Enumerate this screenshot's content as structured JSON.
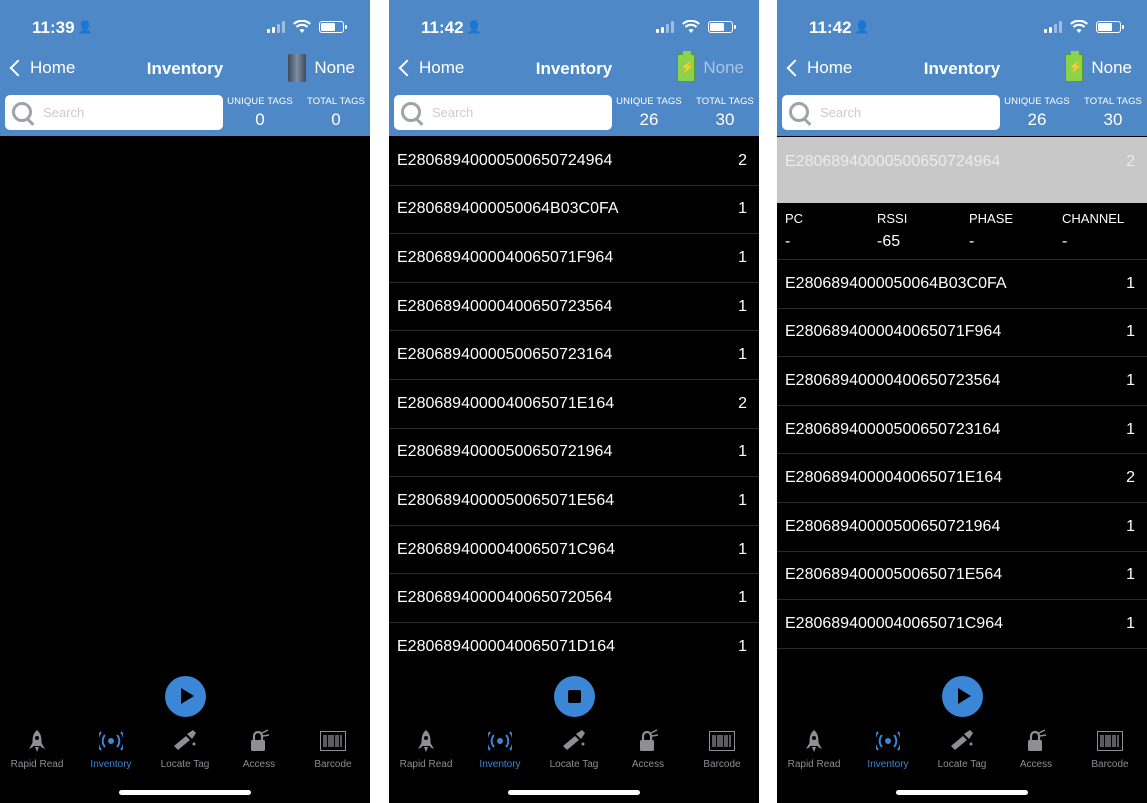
{
  "screens": [
    {
      "time": "11:39",
      "nav": {
        "back": "Home",
        "title": "Inventory",
        "reader": "None"
      },
      "search_placeholder": "Search",
      "counts": {
        "unique_label": "UNIQUE TAGS",
        "unique": "0",
        "total_label": "TOTAL TAGS",
        "total": "0"
      },
      "tags": [],
      "control": "play"
    },
    {
      "time": "11:42",
      "nav": {
        "back": "Home",
        "title": "Inventory",
        "reader": "None"
      },
      "search_placeholder": "Search",
      "counts": {
        "unique_label": "UNIQUE TAGS",
        "unique": "26",
        "total_label": "TOTAL TAGS",
        "total": "30"
      },
      "tags": [
        {
          "epc": "E2806894000050065072496​4",
          "count": "2"
        },
        {
          "epc": "E2806894000050064B03C0FA",
          "count": "1"
        },
        {
          "epc": "E2806894000040065071F964",
          "count": "1"
        },
        {
          "epc": "E28068940000400650723564",
          "count": "1"
        },
        {
          "epc": "E28068940000500650723164",
          "count": "1"
        },
        {
          "epc": "E2806894000040065071E164",
          "count": "2"
        },
        {
          "epc": "E28068940000500650721964",
          "count": "1"
        },
        {
          "epc": "E2806894000050065071E564",
          "count": "1"
        },
        {
          "epc": "E2806894000040065071C964",
          "count": "1"
        },
        {
          "epc": "E28068940000400650720564",
          "count": "1"
        },
        {
          "epc": "E2806894000040065071D164",
          "count": "1"
        }
      ],
      "control": "stop"
    },
    {
      "time": "11:42",
      "nav": {
        "back": "Home",
        "title": "Inventory",
        "reader": "None"
      },
      "search_placeholder": "Search",
      "counts": {
        "unique_label": "UNIQUE TAGS",
        "unique": "26",
        "total_label": "TOTAL TAGS",
        "total": "30"
      },
      "selected": {
        "epc": "E28068940000500650724964",
        "count": "2"
      },
      "details": [
        {
          "label": "PC",
          "value": "-"
        },
        {
          "label": "RSSI",
          "value": "-65"
        },
        {
          "label": "PHASE",
          "value": "-"
        },
        {
          "label": "CHANNEL",
          "value": "-"
        }
      ],
      "tags": [
        {
          "epc": "E2806894000050064B03C0FA",
          "count": "1"
        },
        {
          "epc": "E2806894000040065071F964",
          "count": "1"
        },
        {
          "epc": "E28068940000400650723564",
          "count": "1"
        },
        {
          "epc": "E28068940000500650723164",
          "count": "1"
        },
        {
          "epc": "E2806894000040065071E164",
          "count": "2"
        },
        {
          "epc": "E28068940000500650721964",
          "count": "1"
        },
        {
          "epc": "E2806894000050065071E564",
          "count": "1"
        },
        {
          "epc": "E2806894000040065071C964",
          "count": "1"
        }
      ],
      "control": "play"
    }
  ],
  "tabs": [
    {
      "label": "Rapid Read",
      "icon": "rapid-read-icon"
    },
    {
      "label": "Inventory",
      "icon": "inventory-icon",
      "active": true
    },
    {
      "label": "Locate Tag",
      "icon": "locate-tag-icon"
    },
    {
      "label": "Access",
      "icon": "access-icon"
    },
    {
      "label": "Barcode",
      "icon": "barcode-icon"
    }
  ],
  "colors": {
    "header": "#4f88c6",
    "accent": "#3b86d6",
    "background": "#000000",
    "inactive_tab": "#8e8e93"
  }
}
